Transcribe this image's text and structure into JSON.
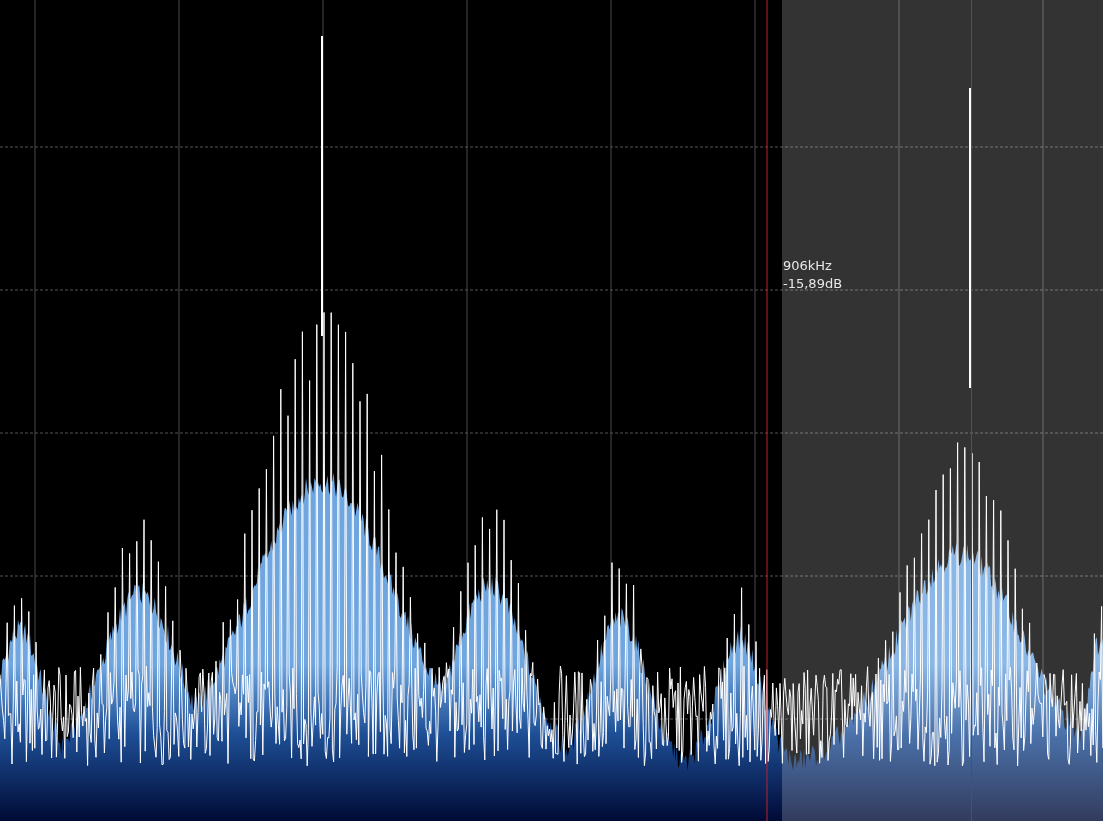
{
  "marker": {
    "frequency": "906kHz",
    "level": "-15,89dB"
  }
}
